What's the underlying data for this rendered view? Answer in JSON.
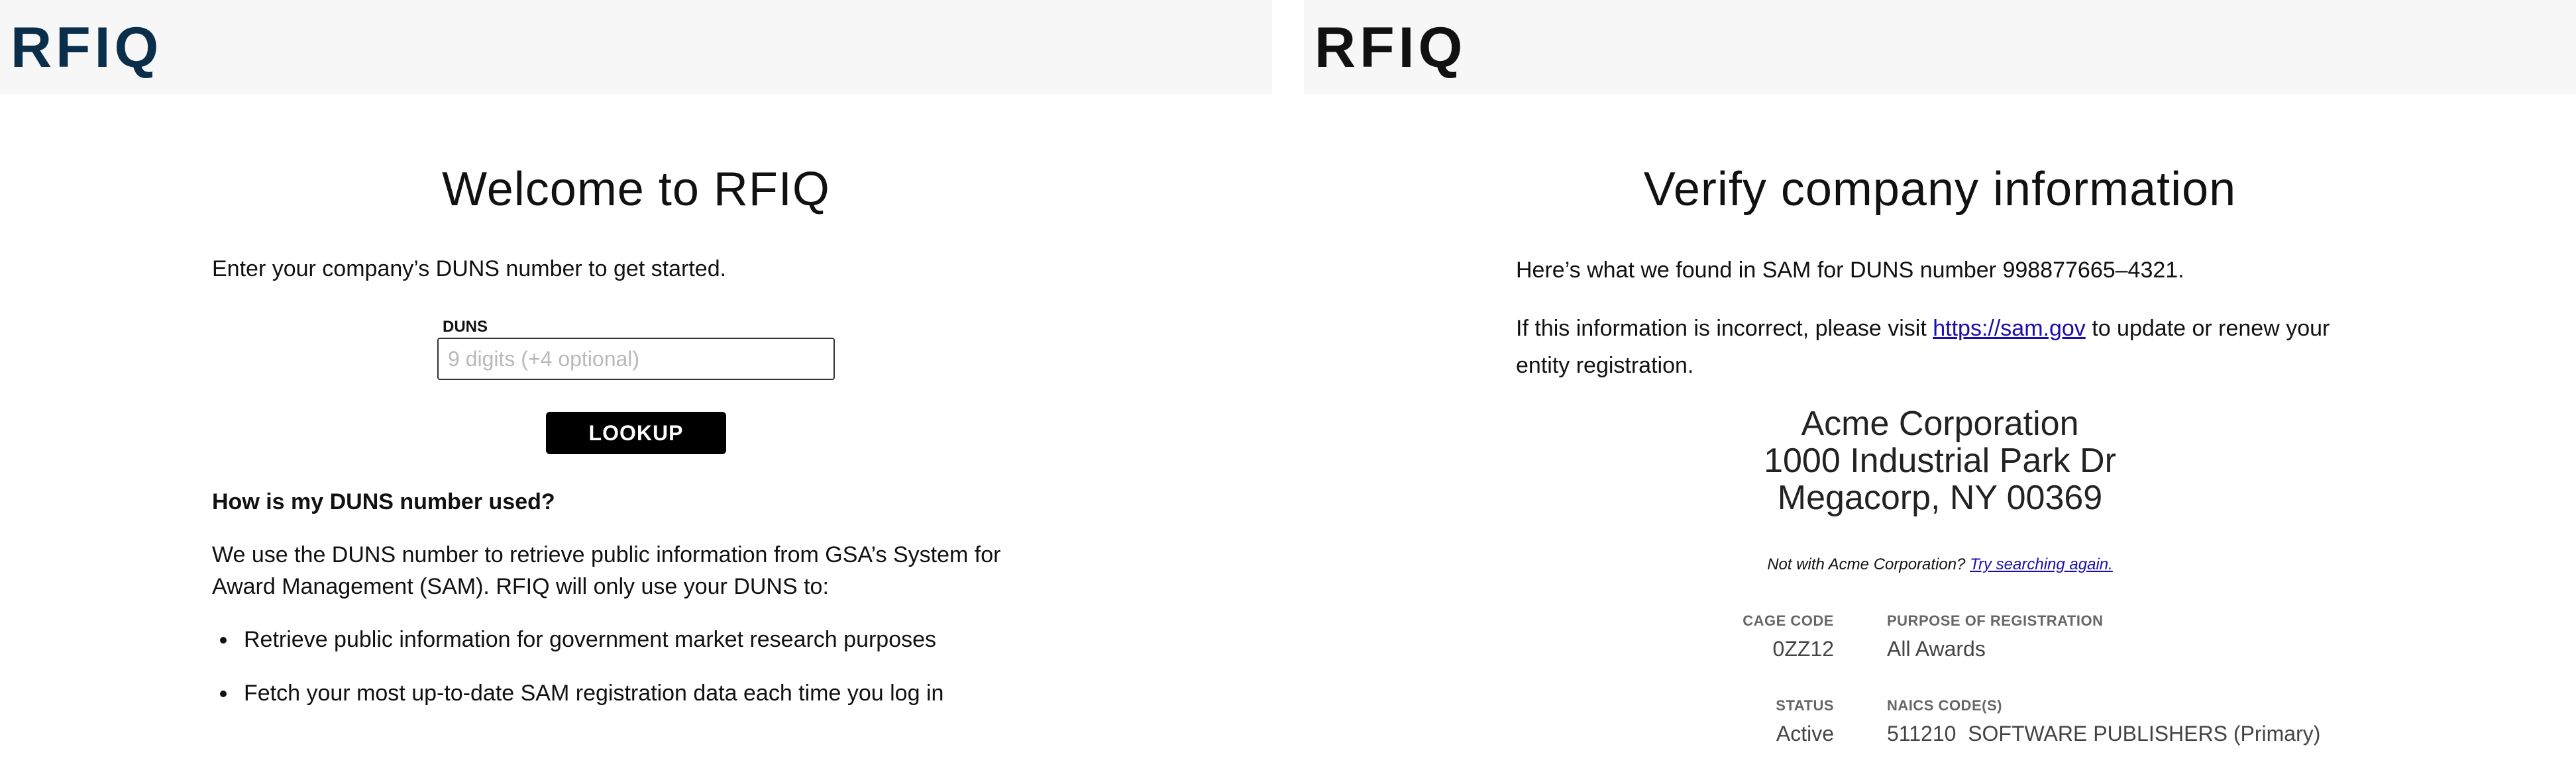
{
  "left": {
    "logo": "RFIQ",
    "title": "Welcome to RFIQ",
    "intro": "Enter your company’s DUNS number to get started.",
    "duns_label": "DUNS",
    "duns_placeholder": "9 digits (+4 optional)",
    "duns_value": "",
    "lookup_label": "LOOKUP",
    "faq_heading": "How is my DUNS number used?",
    "faq_body_line1": "We use the DUNS number to retrieve public information from GSA’s System for",
    "faq_body_line2": "Award Management (SAM). RFIQ will only use your DUNS to:",
    "bullets": [
      "Retrieve public information for government market research purposes",
      "Fetch your most up-to-date SAM registration data each time you log in"
    ]
  },
  "right": {
    "logo": "RFIQ",
    "title": "Verify company information",
    "found_text": "Here’s what we found in SAM for DUNS number 998877665–4321.",
    "incorrect_prefix": "If this information is incorrect, please visit",
    "sam_link": "https://sam.gov",
    "incorrect_suffix": "to update or renew your",
    "incorrect_line2": "entity registration.",
    "company_name": "Acme Corporation",
    "company_address1": "1000 Industrial Park Dr",
    "company_address2": "Megacorp, NY  00369",
    "not_with_prefix": "Not with Acme Corporation?",
    "try_again_link": "Try searching again.",
    "cage_code_label": "CAGE CODE",
    "cage_code_value": "0ZZ12",
    "purpose_label": "PURPOSE OF REGISTRATION",
    "purpose_value": "All Awards",
    "status_label": "STATUS",
    "status_value": "Active",
    "naics_label": "NAICS CODE(S)",
    "naics_value": "511210  SOFTWARE PUBLISHERS (Primary)"
  }
}
